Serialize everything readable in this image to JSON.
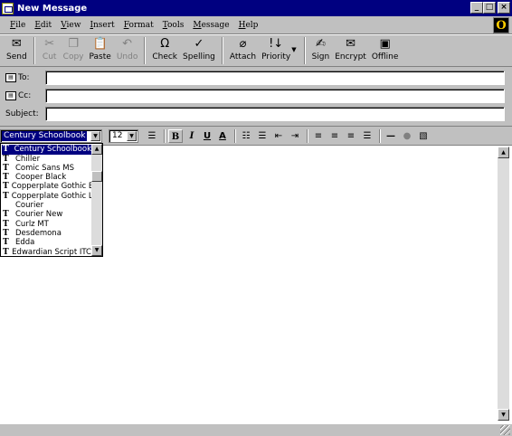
{
  "window": {
    "title": "New Message",
    "minimize": "_",
    "maximize": "□",
    "close": "×"
  },
  "menu": {
    "items": [
      "File",
      "Edit",
      "View",
      "Insert",
      "Format",
      "Tools",
      "Message",
      "Help"
    ],
    "logo": "O"
  },
  "toolbar": {
    "send": "Send",
    "cut": "Cut",
    "copy": "Copy",
    "paste": "Paste",
    "undo": "Undo",
    "check": "Check",
    "spelling": "Spelling",
    "attach": "Attach",
    "priority": "Priority",
    "sign": "Sign",
    "encrypt": "Encrypt",
    "offline": "Offline"
  },
  "address": {
    "to_label": "To:",
    "cc_label": "Cc:",
    "subject_label": "Subject:",
    "to_value": "",
    "cc_value": "",
    "subject_value": ""
  },
  "format": {
    "font_selected": "Century Schoolbook",
    "size_selected": "12",
    "bold": "B",
    "italic": "I",
    "underline": "U",
    "color": "A"
  },
  "font_list": {
    "items": [
      "Century Schoolbook",
      "Chiller",
      "Comic Sans MS",
      "Cooper Black",
      "Copperplate Gothic Bo",
      "Copperplate Gothic Lig",
      "Courier",
      "Courier New",
      "Curlz MT",
      "Desdemona",
      "Edda",
      "Edwardian Script ITC"
    ],
    "truetype": [
      true,
      true,
      true,
      true,
      true,
      true,
      false,
      true,
      true,
      true,
      true,
      true
    ],
    "tt_glyph": "T"
  },
  "colors": {
    "title_bar": "#000080",
    "face": "#c0c0c0",
    "selection": "#000080"
  }
}
